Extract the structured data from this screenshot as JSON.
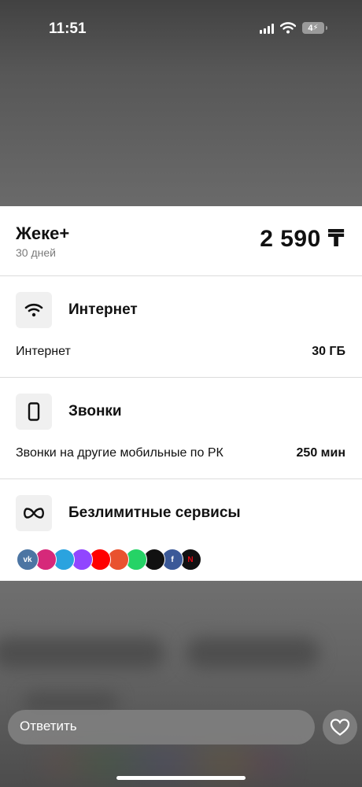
{
  "status_bar": {
    "time": "11:51",
    "battery": "4"
  },
  "plan": {
    "name": "Жеке+",
    "period": "30 дней",
    "price": "2 590 ₸"
  },
  "sections": {
    "internet": {
      "title": "Интернет",
      "row_label": "Интернет",
      "row_value": "30 ГБ",
      "icon": "wifi-icon"
    },
    "calls": {
      "title": "Звонки",
      "row_label": "Звонки на другие мобильные по РК",
      "row_value": "250 мин",
      "icon": "phone-icon"
    },
    "unlimited": {
      "title": "Безлимитные сервисы",
      "icon": "infinity-icon"
    }
  },
  "services": [
    {
      "name": "vk",
      "label": "vk",
      "color": "#4c75a3"
    },
    {
      "name": "instagram",
      "label": "",
      "color": "#d6297a"
    },
    {
      "name": "telegram",
      "label": "",
      "color": "#2aa3df"
    },
    {
      "name": "twitch",
      "label": "",
      "color": "#9146ff"
    },
    {
      "name": "youtube",
      "label": "",
      "color": "#ff0000"
    },
    {
      "name": "likee",
      "label": "",
      "color": "#e9522f"
    },
    {
      "name": "whatsapp",
      "label": "",
      "color": "#25d366"
    },
    {
      "name": "tiktok",
      "label": "",
      "color": "#111111"
    },
    {
      "name": "facebook",
      "label": "f",
      "color": "#3b5998"
    },
    {
      "name": "netflix",
      "label": "N",
      "color": "#111111"
    }
  ],
  "reply": {
    "placeholder": "Ответить"
  }
}
